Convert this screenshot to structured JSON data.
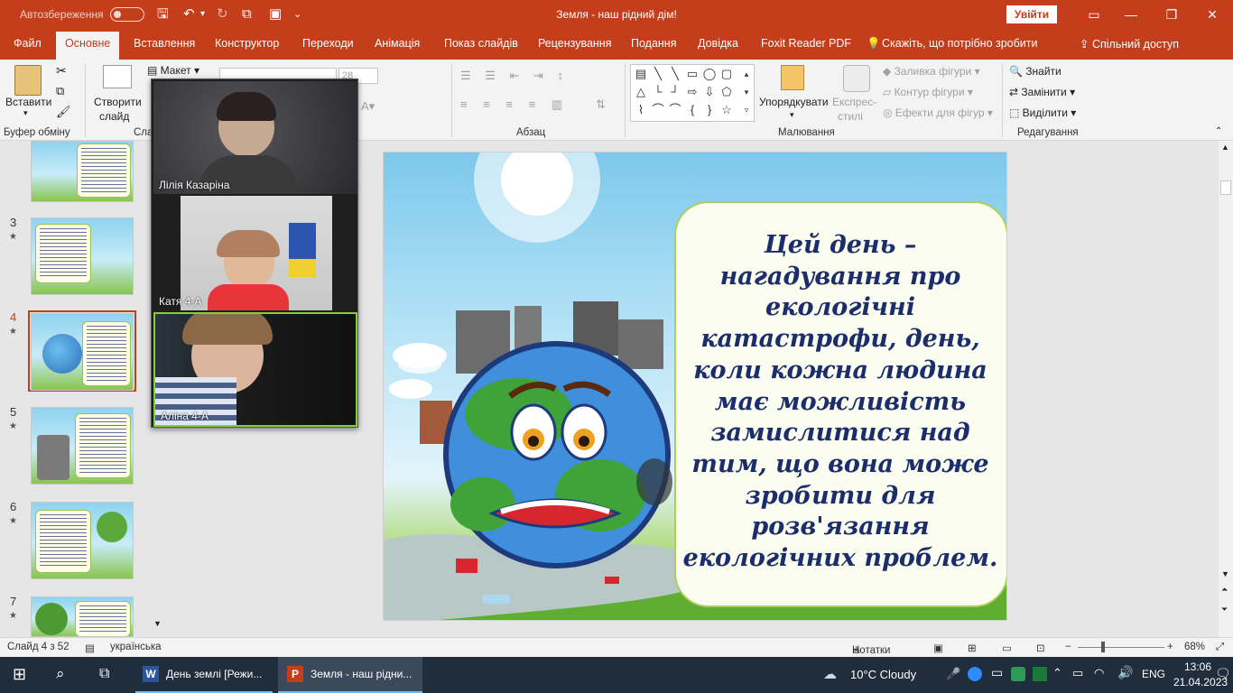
{
  "window": {
    "autosave_label": "Автозбереження",
    "title": "Земля - наш рідний дім!",
    "signin_label": "Увійти"
  },
  "tabs": [
    "Файл",
    "Основне",
    "Вставлення",
    "Конструктор",
    "Переходи",
    "Анімація",
    "Показ слайдів",
    "Рецензування",
    "Подання",
    "Довідка",
    "Foxit Reader PDF",
    "Скажіть, що потрібно зробити"
  ],
  "share_label": "Спільний доступ",
  "ribbon": {
    "paste": "Вставити",
    "clipboard_group": "Буфер обміну",
    "new_slide_line1": "Створити",
    "new_slide_line2": "слайд",
    "layout": "Макет",
    "slides_group": "Сла",
    "font_size": "28",
    "paragraph_group": "Абзац",
    "arrange": "Упорядкувати",
    "quick_styles_line1": "Експрес-",
    "quick_styles_line2": "стилі",
    "shape_fill": "Заливка фігури",
    "shape_outline": "Контур фігури",
    "shape_effects": "Ефекти для фігур",
    "drawing_group": "Малювання",
    "find": "Знайти",
    "replace": "Замінити",
    "select": "Виділити",
    "editing_group": "Редагування"
  },
  "thumbnails": [
    {
      "num": "",
      "star": "",
      "selected": false
    },
    {
      "num": "3",
      "star": "★",
      "selected": false
    },
    {
      "num": "4",
      "star": "★",
      "selected": true
    },
    {
      "num": "5",
      "star": "★",
      "selected": false
    },
    {
      "num": "6",
      "star": "★",
      "selected": false
    },
    {
      "num": "7",
      "star": "★",
      "selected": false
    }
  ],
  "slide": {
    "text": "Цей день – нагадування про екологічні катастрофи, день, коли кожна людина має можливість замислитися над тим, що вона може зробити для розв'язання екологічних проблем."
  },
  "zoom": {
    "participants": [
      {
        "name": "Лілія Казаріна",
        "active": false
      },
      {
        "name": "Катя  4-А",
        "active": false
      },
      {
        "name": "Аліна 4-А",
        "active": true
      }
    ]
  },
  "status": {
    "slide_counter": "Слайд 4 з 52",
    "language": "українська",
    "notes": "Нотатки",
    "zoom": "68%"
  },
  "taskbar": {
    "word_window": "День землі [Режи...",
    "ppt_window": "Земля - наш рідни...",
    "weather": "10°C  Cloudy",
    "lang": "ENG",
    "time": "13:06",
    "date": "21.04.2023"
  },
  "colors": {
    "accent": "#c43e1c",
    "slide_text": "#1b2d6b",
    "taskbar": "#1f2d3d"
  }
}
